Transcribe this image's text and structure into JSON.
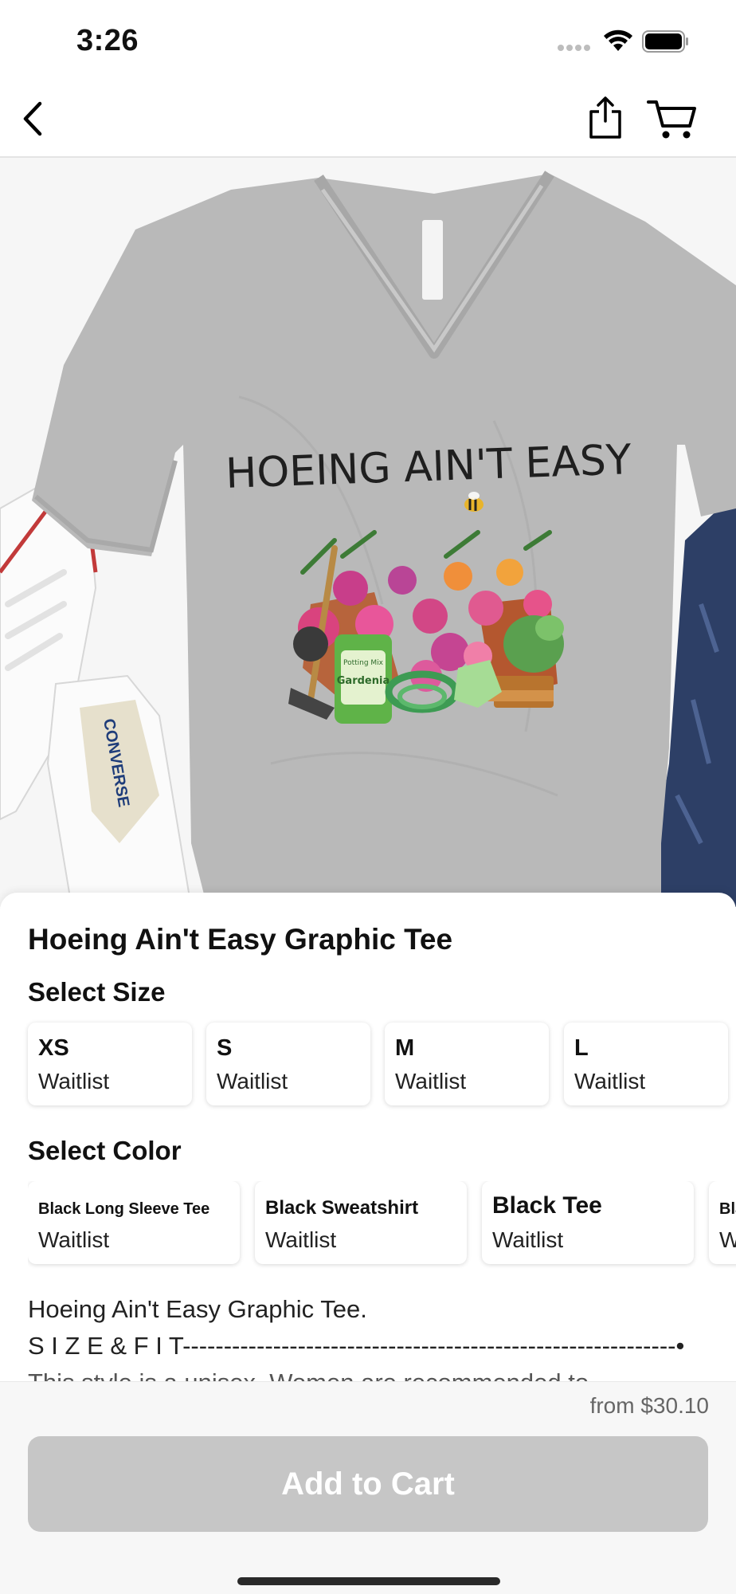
{
  "status_bar": {
    "time": "3:26"
  },
  "hero": {
    "shirt_print_text": "HOEING AIN'T EASY",
    "bag_label_top": "Potting Mix",
    "bag_label_main": "Gardenia",
    "shoe_brand": "CONVERSE"
  },
  "product": {
    "title": "Hoeing Ain't Easy Graphic Tee"
  },
  "size_section": {
    "label": "Select Size",
    "options": [
      {
        "name": "XS",
        "status": "Waitlist"
      },
      {
        "name": "S",
        "status": "Waitlist"
      },
      {
        "name": "M",
        "status": "Waitlist"
      },
      {
        "name": "L",
        "status": "Waitlist"
      }
    ]
  },
  "color_section": {
    "label": "Select Color",
    "options": [
      {
        "name": "Black Long Sleeve Tee",
        "status": "Waitlist"
      },
      {
        "name": "Black Sweatshirt",
        "status": "Waitlist"
      },
      {
        "name": "Black Tee",
        "status": "Waitlist"
      },
      {
        "name": "Bla",
        "status": "W"
      }
    ]
  },
  "description": {
    "line1": "Hoeing Ain't Easy Graphic Tee.",
    "line2": "S I Z E & F I T------------------------------------------------------------•",
    "line3": "This style is a unisex. Women are recommended to"
  },
  "footer": {
    "price": "from $30.10",
    "add_to_cart": "Add to Cart"
  },
  "colors": {
    "shirt": "#b9b9b9",
    "button_disabled": "#c6c6c6",
    "accent_pink": "#d9437e"
  }
}
